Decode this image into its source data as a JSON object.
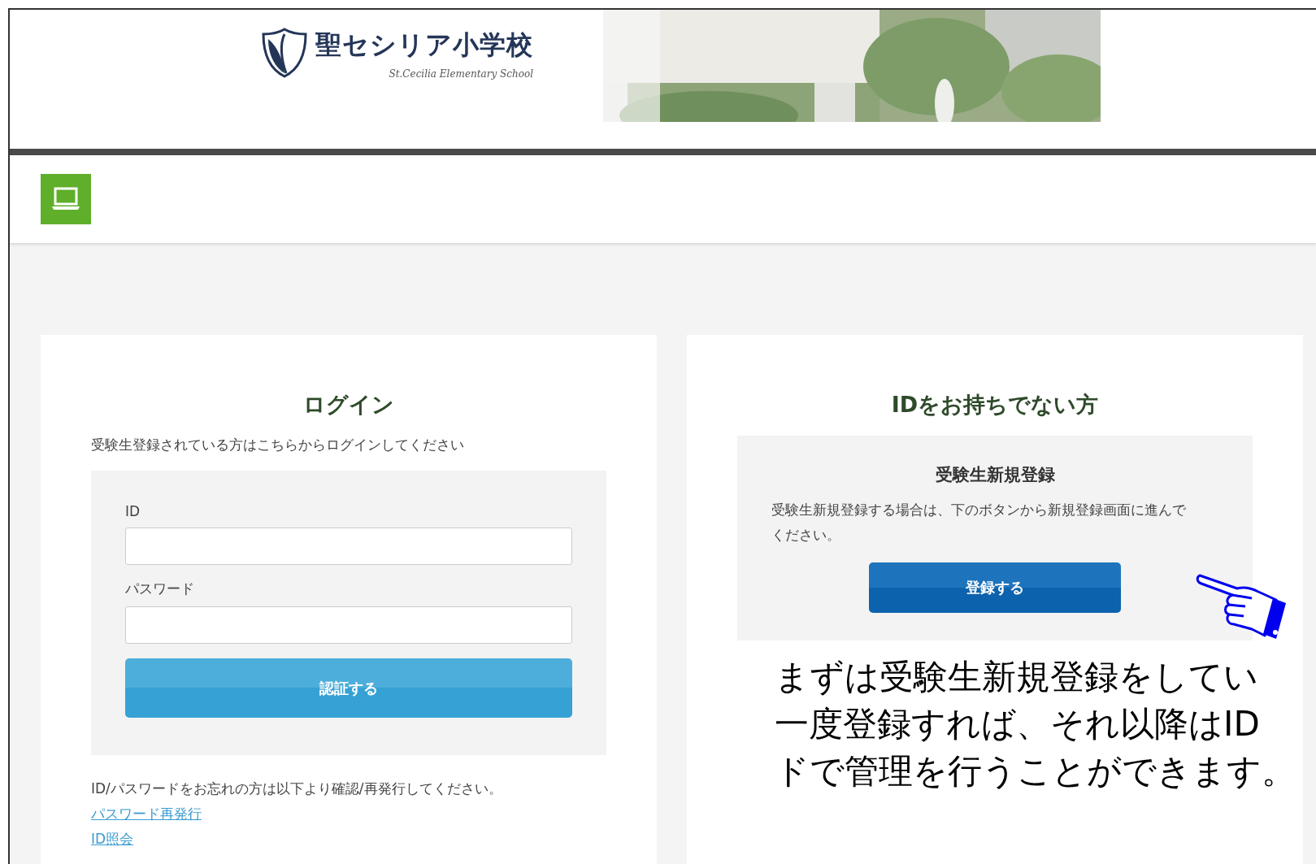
{
  "header": {
    "school_name": "聖セシリア小学校",
    "school_name_en": "St.Cecilia Elementary School"
  },
  "login": {
    "title": "ログイン",
    "intro": "受験生登録されている方はこちらからログインしてください",
    "fields": [
      {
        "label": "ID"
      },
      {
        "label": "パスワード"
      }
    ],
    "button": "認証する",
    "forgot_text": "ID/パスワードをお忘れの方は以下より確認/再発行してください。",
    "links": [
      "パスワード再発行",
      "ID照会"
    ]
  },
  "register": {
    "title": "IDをお持ちでない方",
    "box_title": "受験生新規登録",
    "box_text": "受験生新規登録する場合は、下のボタンから新規登録画面に進んでください。",
    "button": "登録する"
  },
  "annotation": {
    "lines": [
      "まずは受験生新規登録をしてい",
      "一度登録すれば、それ以降はID",
      "ドで管理を行うことができます。"
    ]
  }
}
